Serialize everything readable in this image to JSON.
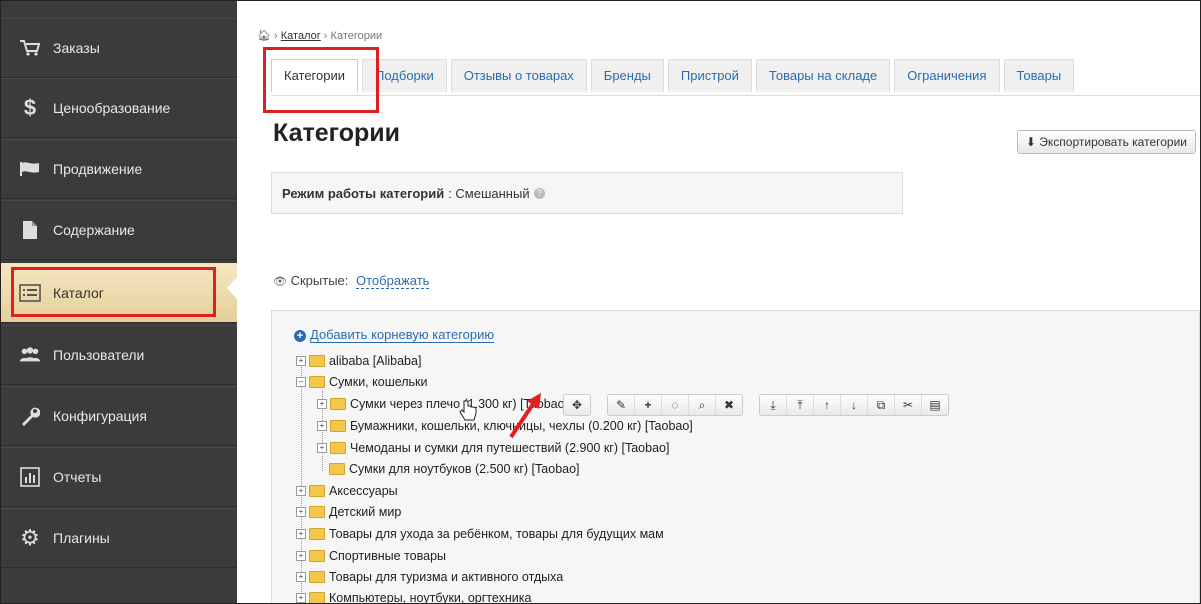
{
  "sidebar": {
    "items": [
      {
        "label": "Заказы",
        "icon": "cart-icon"
      },
      {
        "label": "Ценообразование",
        "icon": "dollar-icon"
      },
      {
        "label": "Продвижение",
        "icon": "flag-icon"
      },
      {
        "label": "Содержание",
        "icon": "file-icon"
      },
      {
        "label": "Каталог",
        "icon": "list-icon"
      },
      {
        "label": "Пользователи",
        "icon": "users-icon"
      },
      {
        "label": "Конфигурация",
        "icon": "wrench-icon"
      },
      {
        "label": "Отчеты",
        "icon": "chart-icon"
      },
      {
        "label": "Плагины",
        "icon": "gear-icon"
      }
    ],
    "active": "Каталог"
  },
  "breadcrumb": {
    "home_icon": "home-icon",
    "catalog": "Каталог",
    "current": "Категории"
  },
  "tabs": [
    "Категории",
    "Подборки",
    "Отзывы о товарах",
    "Бренды",
    "Пристрой",
    "Товары на складе",
    "Ограничения",
    "Товары"
  ],
  "page": {
    "title": "Категории",
    "export_label": "Экспортировать категории",
    "mode_label": "Режим работы категорий",
    "mode_value": ": Смешанный",
    "hidden_label": "Скрытые:",
    "hidden_link": "Отображать",
    "add_root": "Добавить корневую категорию"
  },
  "tree": [
    "alibaba [Alibaba]",
    "Сумки, кошельки",
    "Сумки через плечо (1.300 кг) [Taobao]",
    "Бумажники, кошельки, ключницы, чехлы (0.200 кг) [Taobao]",
    "Чемоданы и сумки для путешествий (2.900 кг) [Taobao]",
    "Сумки для ноутбуков (2.500 кг) [Taobao]",
    "Аксессуары",
    "Детский мир",
    "Товары для ухода за ребёнком, товары для будущих мам",
    "Спортивные товары",
    "Товары для туризма и активного отдыха",
    "Компьютеры, ноутбуки, оргтехника"
  ],
  "colors": {
    "sidebar": "#3b3b3b",
    "active": "#f0dfb0",
    "highlight": "#e02020",
    "link": "#2b6cb0"
  }
}
